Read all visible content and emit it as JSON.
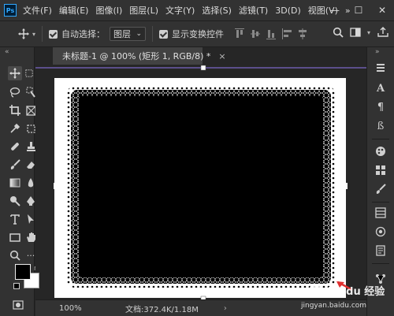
{
  "app": {
    "logo_text": "Ps"
  },
  "menu": {
    "items": [
      "文件(F)",
      "编辑(E)",
      "图像(I)",
      "图层(L)",
      "文字(Y)",
      "选择(S)",
      "滤镜(T)",
      "3D(D)",
      "视图(V)"
    ],
    "more": "»",
    "window_controls": [
      "—",
      "☐",
      "✕"
    ]
  },
  "options": {
    "auto_select_label": "自动选择：",
    "auto_select_checked": true,
    "auto_select_target": "图层",
    "show_transform_label": "显示变换控件",
    "show_transform_checked": true,
    "more": "···"
  },
  "left_collapse": "«",
  "right_collapse": "»",
  "document": {
    "tab_title": "未标题-1 @ 100% (矩形 1, RGB/8) *",
    "close_glyph": "×"
  },
  "status": {
    "zoom": "100%",
    "doc_info": "文档:372.4K/1.18M",
    "arrow": "›"
  },
  "colors": {
    "background": "#262626",
    "panel": "#323232",
    "selection_line": "#7b68c8",
    "foreground_swatch": "#000000",
    "background_swatch": "#ffffff"
  },
  "watermark": {
    "brand": "Baidu 经验",
    "url": "jingyan.baidu.com"
  }
}
